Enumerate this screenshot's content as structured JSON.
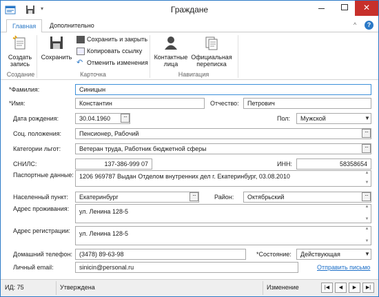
{
  "window": {
    "title": "Граждане"
  },
  "tabs": [
    "Главная",
    "Дополнительно"
  ],
  "ribbon": {
    "create": "Создать запись",
    "save": "Сохранить",
    "save_close": "Сохранить и закрыть",
    "copy_link": "Копировать ссылку",
    "undo": "Отменить изменения",
    "contacts": "Контактные лица",
    "official": "Официальная переписка",
    "group_create": "Создание",
    "group_card": "Карточка",
    "group_nav": "Навигация"
  },
  "form": {
    "surname_label": "*Фамилия:",
    "surname": "Синицын",
    "name_label": "*Имя:",
    "name": "Константин",
    "patronymic_label": "Отчество:",
    "patronymic": "Петрович",
    "birth_label": "Дата рождения:",
    "birth": "30.04.1960",
    "gender_label": "Пол:",
    "gender": "Мужской",
    "social_label": "Соц. положения:",
    "social": "Пенсионер, Рабочий",
    "benefits_label": "Категории льгот:",
    "benefits": "Ветеран труда, Работник бюджетной сферы",
    "snils_label": "СНИЛС:",
    "snils": "137-386-999 07",
    "inn_label": "ИНН:",
    "inn": "58358654",
    "passport_label": "Паспортные данные:",
    "passport": "1206 969787 Выдан Отделом внутренних дел г. Екатеринбург, 03.08.2010",
    "city_label": "Населенный пункт:",
    "city": "Екатеринбург",
    "district_label": "Район:",
    "district": "Октябрьский",
    "residence_label": "Адрес проживания:",
    "residence": "ул. Ленина 128-5",
    "registration_label": "Адрес регистрации:",
    "registration": "ул. Ленина 128-5",
    "phone_label": "Домашний телефон:",
    "phone": "(3478) 89-63-98",
    "state_label": "*Состояние:",
    "state": "Действующая",
    "email_label": "Личный email:",
    "email": "sinicin@personal.ru",
    "send_mail": "Отправить письмо"
  },
  "status": {
    "id": "ИД: 75",
    "approved": "Утверждена",
    "mode": "Изменение"
  }
}
